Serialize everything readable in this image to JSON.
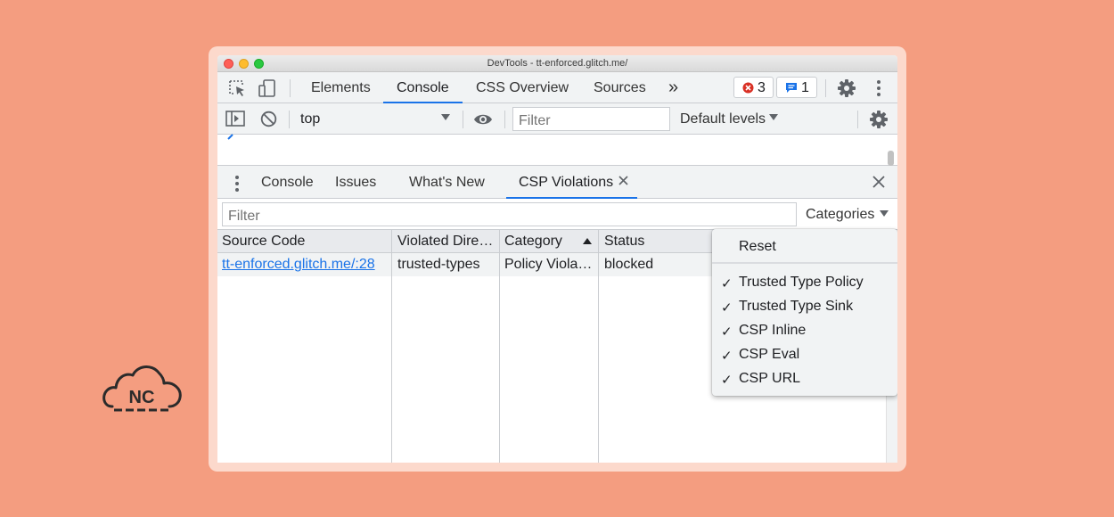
{
  "window": {
    "title": "DevTools - tt-enforced.glitch.me/"
  },
  "main_tabs": [
    {
      "label": "Elements"
    },
    {
      "label": "Console"
    },
    {
      "label": "CSS Overview"
    },
    {
      "label": "Sources"
    }
  ],
  "main_tabs_more": "»",
  "badges": {
    "errors": "3",
    "messages": "1"
  },
  "console_toolbar": {
    "context": "top",
    "filter_placeholder": "Filter",
    "levels": "Default levels"
  },
  "drawer_tabs": [
    {
      "label": "Console"
    },
    {
      "label": "Issues"
    },
    {
      "label": "What's New"
    },
    {
      "label": "CSP Violations"
    }
  ],
  "csp": {
    "filter_placeholder": "Filter",
    "categories_label": "Categories",
    "columns": [
      "Source Code",
      "Violated Dire…",
      "Category",
      "Status"
    ],
    "rows": [
      {
        "source": "tt-enforced.glitch.me/:28",
        "directive": "trusted-types",
        "category": "Policy Viola…",
        "status": "blocked"
      }
    ]
  },
  "categories_menu": {
    "reset": "Reset",
    "items": [
      {
        "label": "Trusted Type Policy",
        "checked": true
      },
      {
        "label": "Trusted Type Sink",
        "checked": true
      },
      {
        "label": "CSP Inline",
        "checked": true
      },
      {
        "label": "CSP Eval",
        "checked": true
      },
      {
        "label": "CSP URL",
        "checked": true
      }
    ]
  },
  "brand": {
    "logo_text": "NC"
  },
  "colors": {
    "background": "#f49d80",
    "accent": "#1a73e8",
    "error": "#d93025",
    "link": "#1a73e8"
  }
}
